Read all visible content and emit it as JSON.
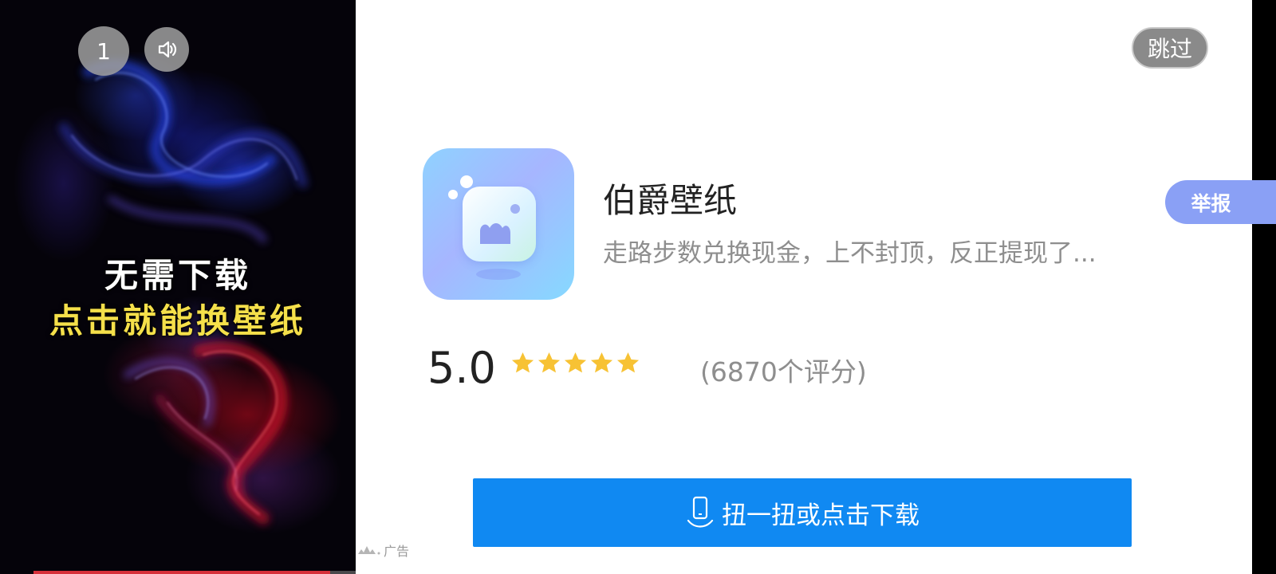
{
  "video": {
    "page_counter": "1",
    "caption_line1": "无需下载",
    "caption_line2": "点击就能换壁纸",
    "progress": 0.92,
    "progress_color": "#d6303a",
    "caption_highlight_color": "#f5e04a"
  },
  "ad": {
    "skip_label": "跳过",
    "app_name": "伯爵壁纸",
    "app_description": "走路步数兑换现金，上不封顶，反正提现了...",
    "rating": "5.0",
    "stars": 5,
    "rating_count": "(6870个评分)",
    "download_label": "扭一扭或点击下载",
    "ad_label": "广告",
    "report_label": "举报",
    "button_color": "#1089f2",
    "star_color": "#f7c234"
  }
}
